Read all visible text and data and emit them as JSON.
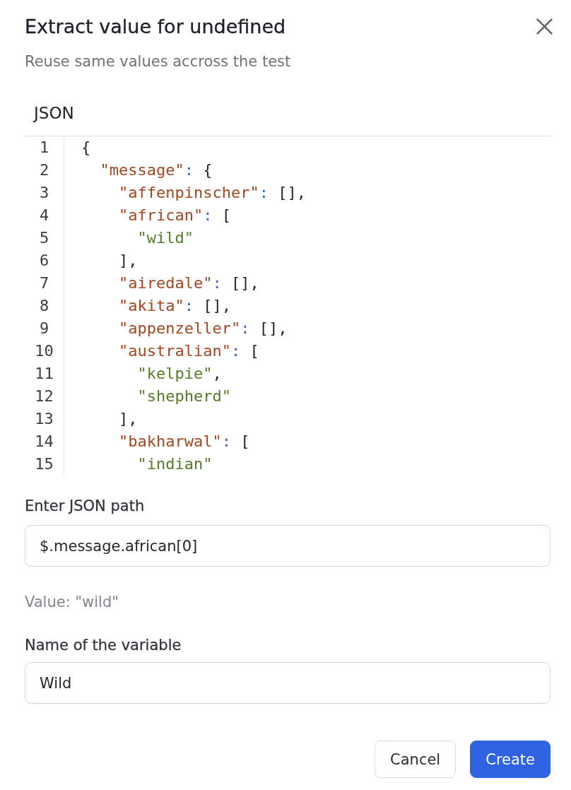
{
  "dialog": {
    "title": "Extract value for undefined",
    "subtitle": "Reuse same values accross the test"
  },
  "editor": {
    "label": "JSON",
    "lines": [
      {
        "number": "1",
        "code": "{"
      },
      {
        "number": "2",
        "code": "  \"message\": {"
      },
      {
        "number": "3",
        "code": "    \"affenpinscher\": [],"
      },
      {
        "number": "4",
        "code": "    \"african\": ["
      },
      {
        "number": "5",
        "code": "      \"wild\""
      },
      {
        "number": "6",
        "code": "    ],"
      },
      {
        "number": "7",
        "code": "    \"airedale\": [],"
      },
      {
        "number": "8",
        "code": "    \"akita\": [],"
      },
      {
        "number": "9",
        "code": "    \"appenzeller\": [],"
      },
      {
        "number": "10",
        "code": "    \"australian\": ["
      },
      {
        "number": "11",
        "code": "      \"kelpie\","
      },
      {
        "number": "12",
        "code": "      \"shepherd\""
      },
      {
        "number": "13",
        "code": "    ],"
      },
      {
        "number": "14",
        "code": "    \"bakharwal\": ["
      },
      {
        "number": "15",
        "code": "      \"indian\""
      }
    ]
  },
  "path_field": {
    "label": "Enter JSON path",
    "value": "$.message.african[0]"
  },
  "result": "Value: \"wild\"",
  "name_field": {
    "label": "Name of the variable",
    "value": "Wild"
  },
  "buttons": [
    {
      "label": "Cancel",
      "kind": "secondary"
    },
    {
      "label": "Create",
      "kind": "primary"
    }
  ]
}
